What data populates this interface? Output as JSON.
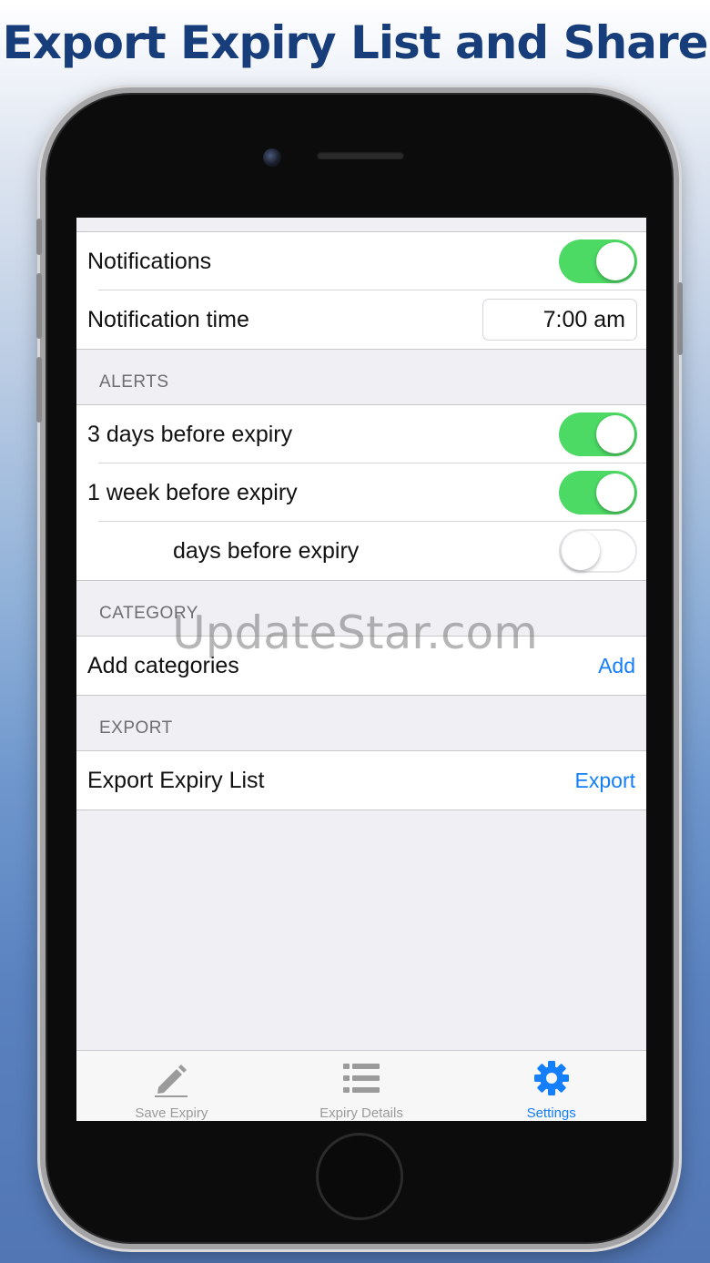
{
  "headline": "Export Expiry List and Share",
  "settings": {
    "notifications": {
      "label": "Notifications",
      "enabled": true
    },
    "notification_time": {
      "label": "Notification time",
      "value": "7:00 am"
    },
    "alerts": {
      "header": "ALERTS",
      "items": [
        {
          "label": "3 days before expiry",
          "enabled": true
        },
        {
          "label": "1 week before expiry",
          "enabled": true
        },
        {
          "label": "days before expiry",
          "enabled": false
        }
      ]
    },
    "category": {
      "header": "CATEGORY",
      "label": "Add categories",
      "action": "Add"
    },
    "export": {
      "header": "EXPORT",
      "label": "Export Expiry List",
      "action": "Export"
    }
  },
  "tabs": [
    {
      "label": "Save Expiry",
      "icon": "pencil-icon",
      "active": false
    },
    {
      "label": "Expiry Details",
      "icon": "list-icon",
      "active": false
    },
    {
      "label": "Settings",
      "icon": "gear-icon",
      "active": true
    }
  ],
  "watermark": "UpdateStar.com",
  "colors": {
    "toggle_on": "#4cd964",
    "accent": "#147efb",
    "headline": "#173e7a",
    "tab_inactive": "#9b9b9b"
  }
}
